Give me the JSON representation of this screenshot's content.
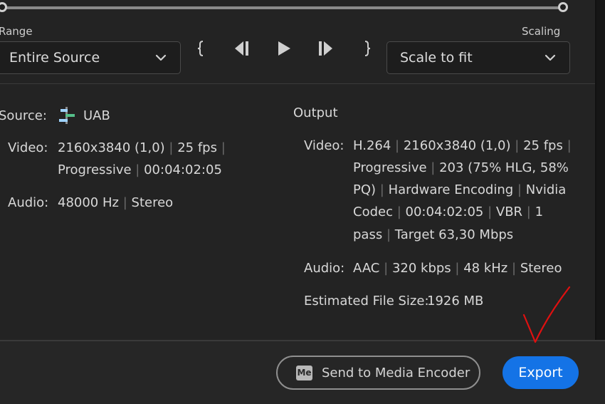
{
  "range": {
    "label": "Range",
    "value": "Entire Source"
  },
  "scaling": {
    "label": "Scaling",
    "value": "Scale to fit"
  },
  "source": {
    "label": "Source:",
    "name": "UAB",
    "video_label": "Video:",
    "video_line1": "2160x3840 (1,0)",
    "video_line1b": "25 fps",
    "video_line2": "Progressive",
    "video_line2b": "00:04:02:05",
    "audio_label": "Audio:",
    "audio_a": "48000 Hz",
    "audio_b": "Stereo"
  },
  "output": {
    "heading": "Output",
    "video_label": "Video:",
    "v1": "H.264",
    "v2": "2160x3840 (1,0)",
    "v3": "25 fps",
    "v4": "Progressive",
    "v5": "203 (75% HLG, 58%",
    "v6": "PQ)",
    "v7": "Hardware Encoding",
    "v8": "Nvidia",
    "v9": "Codec",
    "v10": "00:04:02:05",
    "v11": "VBR",
    "v12": "1",
    "v13": "pass",
    "v14": "Target 63,30 Mbps",
    "audio_label": "Audio:",
    "a1": "AAC",
    "a2": "320 kbps",
    "a3": "48 kHz",
    "a4": "Stereo",
    "size_label": "Estimated File Size:",
    "size_value": "1926 MB"
  },
  "footer": {
    "send_label": "Send to Media Encoder",
    "me_badge": "Me",
    "export_label": "Export"
  },
  "colors": {
    "accent": "#1473e6",
    "annotation": "#e01010"
  },
  "icons": [
    "chevron-down-icon",
    "mark-in-icon",
    "step-back-icon",
    "play-icon",
    "step-forward-icon",
    "mark-out-icon",
    "sequence-icon",
    "media-encoder-icon"
  ]
}
